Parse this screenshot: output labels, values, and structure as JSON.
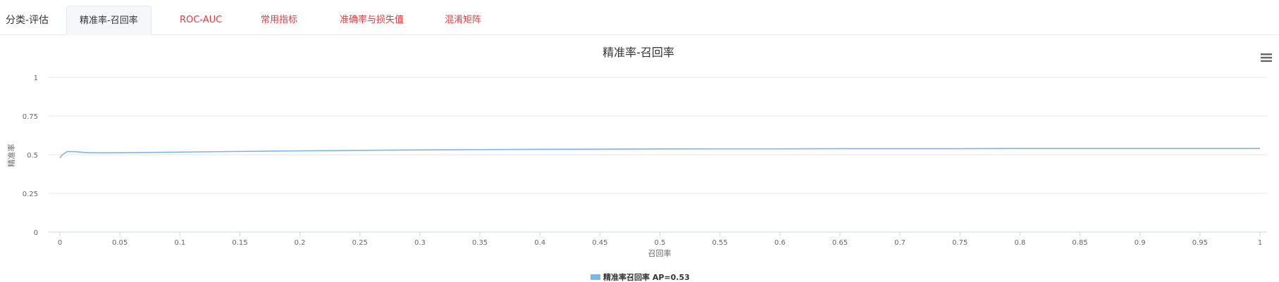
{
  "tabs": {
    "group_title": "分类-评估",
    "items": [
      {
        "label": "精准率-召回率",
        "active": true
      },
      {
        "label": "ROC-AUC",
        "active": false
      },
      {
        "label": "常用指标",
        "active": false
      },
      {
        "label": "准确率与损失值",
        "active": false
      },
      {
        "label": "混淆矩阵",
        "active": false
      }
    ]
  },
  "colors": {
    "accent_red": "#e8383d",
    "series_blue": "#7cb5ec",
    "grid": "#e6e6e6"
  },
  "chart_data": {
    "type": "line",
    "title": "精准率-召回率",
    "xlabel": "召回率",
    "ylabel": "精准率",
    "xlim": [
      0,
      1
    ],
    "ylim": [
      0,
      1
    ],
    "xticks": [
      0,
      0.05,
      0.1,
      0.15,
      0.2,
      0.25,
      0.3,
      0.35,
      0.4,
      0.45,
      0.5,
      0.55,
      0.6,
      0.65,
      0.7,
      0.75,
      0.8,
      0.85,
      0.9,
      0.95,
      1
    ],
    "xtick_labels": [
      "0",
      "0.05",
      "0.1",
      "0.15",
      "0.2",
      "0.25",
      "0.3",
      "0.35",
      "0.4",
      "0.45",
      "0.5",
      "0.55",
      "0.6",
      "0.65",
      "0.7",
      "0.75",
      "0.8",
      "0.85",
      "0.9",
      "0.95",
      "1"
    ],
    "yticks": [
      0,
      0.25,
      0.5,
      0.75,
      1
    ],
    "ytick_labels": [
      "0",
      "0.25",
      "0.5",
      "0.75",
      "1"
    ],
    "grid": true,
    "legend_position": "bottom-center",
    "series": [
      {
        "name": "精准率召回率 AP=0.53",
        "x": [
          0,
          0.002,
          0.004,
          0.006,
          0.008,
          0.012,
          0.02,
          0.03,
          0.05,
          0.1,
          0.15,
          0.2,
          0.25,
          0.3,
          0.35,
          0.4,
          0.45,
          0.5,
          0.55,
          0.6,
          0.65,
          0.7,
          0.75,
          0.8,
          0.85,
          0.9,
          0.95,
          1
        ],
        "y": [
          0.48,
          0.5,
          0.51,
          0.52,
          0.52,
          0.52,
          0.515,
          0.512,
          0.513,
          0.517,
          0.521,
          0.525,
          0.528,
          0.531,
          0.533,
          0.535,
          0.536,
          0.537,
          0.538,
          0.538,
          0.539,
          0.539,
          0.539,
          0.54,
          0.54,
          0.54,
          0.54,
          0.54
        ]
      }
    ]
  }
}
